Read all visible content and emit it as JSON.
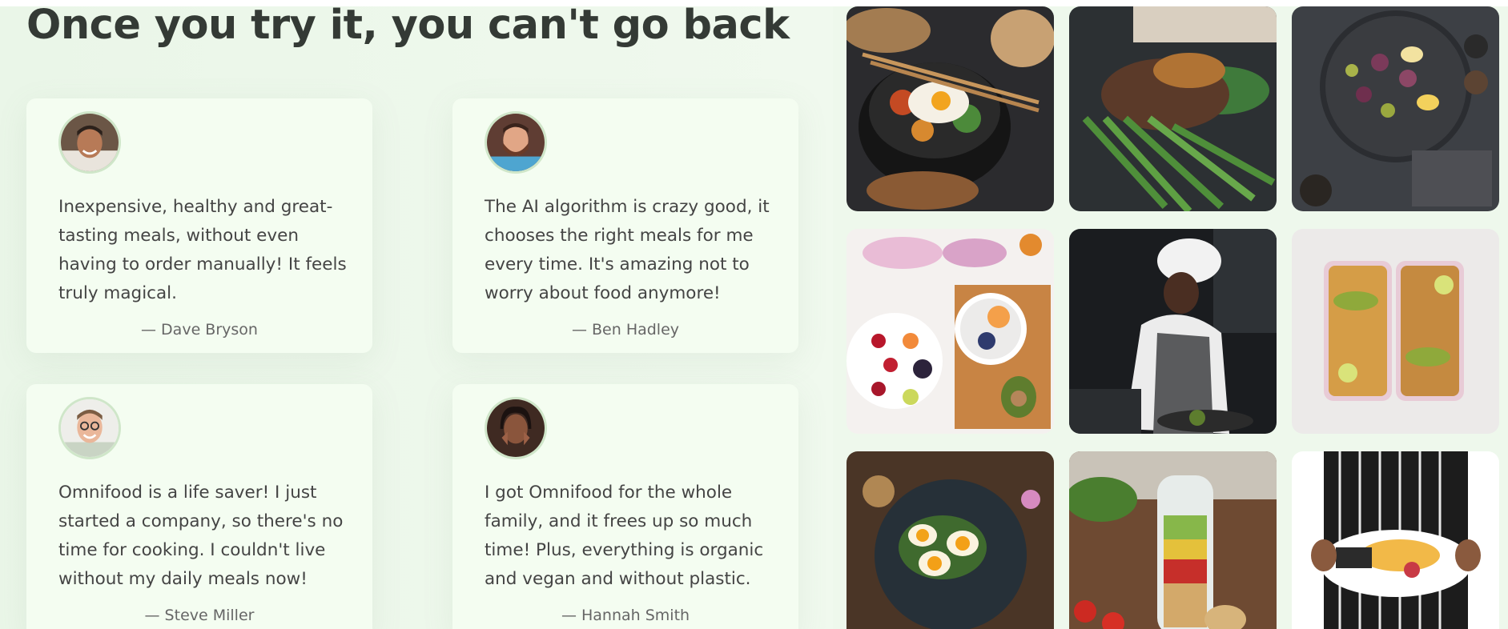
{
  "heading": "Once you try it, you can't go back",
  "testimonials": [
    {
      "quote": "Inexpensive, healthy and great-tasting meals, without even having to order manually! It feels truly magical.",
      "author": "— Dave Bryson",
      "avatar": "man-smiling-avatar"
    },
    {
      "quote": "The AI algorithm is crazy good, it chooses the right meals for me every time. It's amazing not to worry about food anymore!",
      "author": "— Ben Hadley",
      "avatar": "bearded-man-avatar"
    },
    {
      "quote": "Omnifood is a life saver! I just started a company, so there's no time for cooking. I couldn't live without my daily meals now!",
      "author": "— Steve Miller",
      "avatar": "man-with-glasses-avatar"
    },
    {
      "quote": "I got Omnifood for the whole family, and it frees up so much time! Plus, everything is organic and vegan and without plastic.",
      "author": "— Hannah Smith",
      "avatar": "woman-avatar"
    }
  ],
  "gallery": [
    {
      "name": "bibimbap-bowl-photo"
    },
    {
      "name": "steak-with-green-beans-photo"
    },
    {
      "name": "fig-and-egg-platter-photo"
    },
    {
      "name": "fruit-and-yogurt-bowl-photo"
    },
    {
      "name": "chef-cooking-photo"
    },
    {
      "name": "chickpea-lunchbox-photo"
    },
    {
      "name": "egg-avocado-toast-photo"
    },
    {
      "name": "salad-jar-photo"
    },
    {
      "name": "plated-salad-held-by-waiter-photo"
    }
  ],
  "colors": {
    "background": "#eef8ec",
    "card": "#f4fdf1",
    "heading": "#343a35",
    "avatar_border": "#cfe6c9"
  }
}
